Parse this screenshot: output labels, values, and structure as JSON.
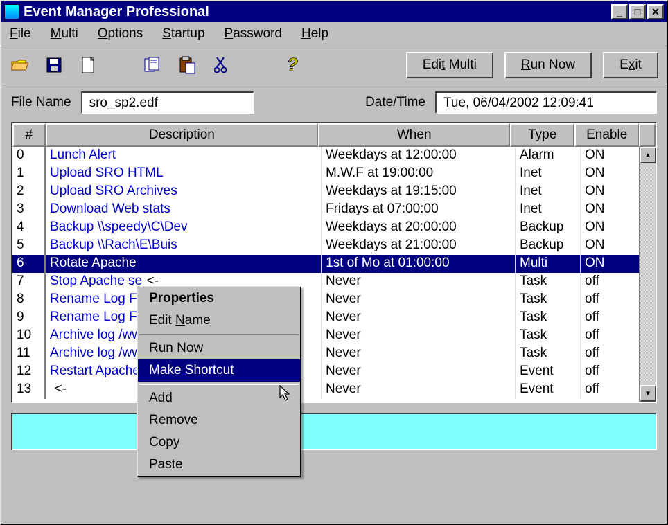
{
  "window": {
    "title": "Event Manager Professional"
  },
  "menu": {
    "file": "File",
    "multi": "Multi",
    "options": "Options",
    "startup": "Startup",
    "password": "Password",
    "help": "Help"
  },
  "toolbar": {
    "edit_multi": "Edit Multi",
    "run_now": "Run Now",
    "exit": "Exit"
  },
  "fields": {
    "file_label": "File Name",
    "file_value": "sro_sp2.edf",
    "date_label": "Date/Time",
    "date_value": "Tue, 06/04/2002  12:09:41"
  },
  "grid": {
    "headers": {
      "num": "#",
      "desc": "Description",
      "when": "When",
      "type": "Type",
      "enable": "Enable"
    },
    "rows": [
      {
        "n": "0",
        "desc": "Lunch Alert",
        "when": "Weekdays at 12:00:00",
        "type": "Alarm",
        "en": "ON",
        "sel": false,
        "arrow": false
      },
      {
        "n": "1",
        "desc": "Upload SRO HTML",
        "when": "M.W.F at 19:00:00",
        "type": "Inet",
        "en": "ON",
        "sel": false,
        "arrow": false
      },
      {
        "n": "2",
        "desc": "Upload SRO Archives",
        "when": "Weekdays at 19:15:00",
        "type": "Inet",
        "en": "ON",
        "sel": false,
        "arrow": false
      },
      {
        "n": "3",
        "desc": "Download Web stats",
        "when": "Fridays at 07:00:00",
        "type": "Inet",
        "en": "ON",
        "sel": false,
        "arrow": false
      },
      {
        "n": "4",
        "desc": "Backup \\\\speedy\\C\\Dev",
        "when": "Weekdays at 20:00:00",
        "type": "Backup",
        "en": "ON",
        "sel": false,
        "arrow": false
      },
      {
        "n": "5",
        "desc": "Backup \\\\Rach\\E\\Buis",
        "when": "Weekdays at 21:00:00",
        "type": "Backup",
        "en": "ON",
        "sel": false,
        "arrow": false
      },
      {
        "n": "6",
        "desc": "Rotate Apache",
        "when": "1st of Mo at 01:00:00",
        "type": "Multi",
        "en": "ON",
        "sel": true,
        "arrow": false
      },
      {
        "n": "7",
        "desc": "Stop Apache se",
        "when": "Never",
        "type": "Task",
        "en": "off",
        "sel": false,
        "arrow": true
      },
      {
        "n": "8",
        "desc": "Rename Log File",
        "when": "Never",
        "type": "Task",
        "en": "off",
        "sel": false,
        "arrow": true
      },
      {
        "n": "9",
        "desc": "Rename Log File",
        "when": "Never",
        "type": "Task",
        "en": "off",
        "sel": false,
        "arrow": true
      },
      {
        "n": "10",
        "desc": "Archive log /ww",
        "when": "Never",
        "type": "Task",
        "en": "off",
        "sel": false,
        "arrow": true
      },
      {
        "n": "11",
        "desc": "Archive log /ww",
        "when": "Never",
        "type": "Task",
        "en": "off",
        "sel": false,
        "arrow": true
      },
      {
        "n": "12",
        "desc": "Restart Apache",
        "when": "Never",
        "type": "Event",
        "en": "off",
        "sel": false,
        "arrow": true
      },
      {
        "n": "13",
        "desc": "",
        "when": "Never",
        "type": "Event",
        "en": "off",
        "sel": false,
        "arrow": true
      }
    ]
  },
  "context": {
    "properties": "Properties",
    "edit_name": "Edit Name",
    "run_now": "Run Now",
    "make_shortcut": "Make Shortcut",
    "add": "Add",
    "remove": "Remove",
    "copy": "Copy",
    "paste": "Paste"
  }
}
